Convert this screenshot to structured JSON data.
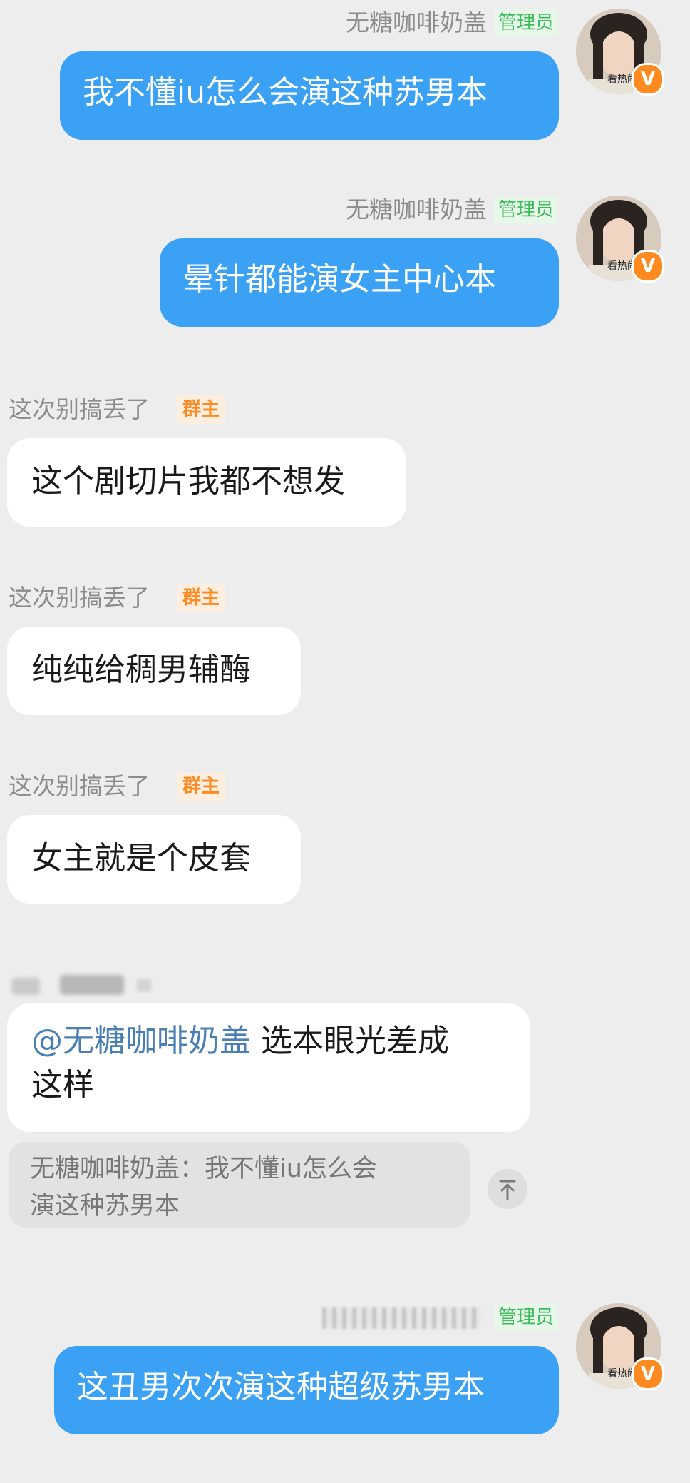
{
  "messages": [
    {
      "sender": "无糖咖啡奶盖",
      "badge": "管理员",
      "text": "我不懂iu怎么会演这种苏男本"
    },
    {
      "sender": "无糖咖啡奶盖",
      "badge": "管理员",
      "text": "晕针都能演女主中心本"
    },
    {
      "sender": "这次别搞丢了",
      "badge": "群主",
      "text": "这个剧切片我都不想发"
    },
    {
      "sender": "这次别搞丢了",
      "badge": "群主",
      "text": "纯纯给稠男辅酶"
    },
    {
      "sender": "这次别搞丢了",
      "badge": "群主",
      "text": "女主就是个皮套"
    },
    {
      "mention": "@无糖咖啡奶盖",
      "text_line1": " 选本眼光差成",
      "text_line2": "这样",
      "quote_line1": "无糖咖啡奶盖：我不懂iu怎么会",
      "quote_line2": "演这种苏男本"
    },
    {
      "badge": "管理员",
      "text": "这丑男次次演这种超级苏男本"
    }
  ],
  "avatar": {
    "label": "看热闹",
    "badge_letter": "V"
  },
  "colors": {
    "background": "#ededed",
    "bubble_blue": "#3aa1f5",
    "admin_badge": "#3cbd5a",
    "owner_badge": "#ff8a1f"
  }
}
